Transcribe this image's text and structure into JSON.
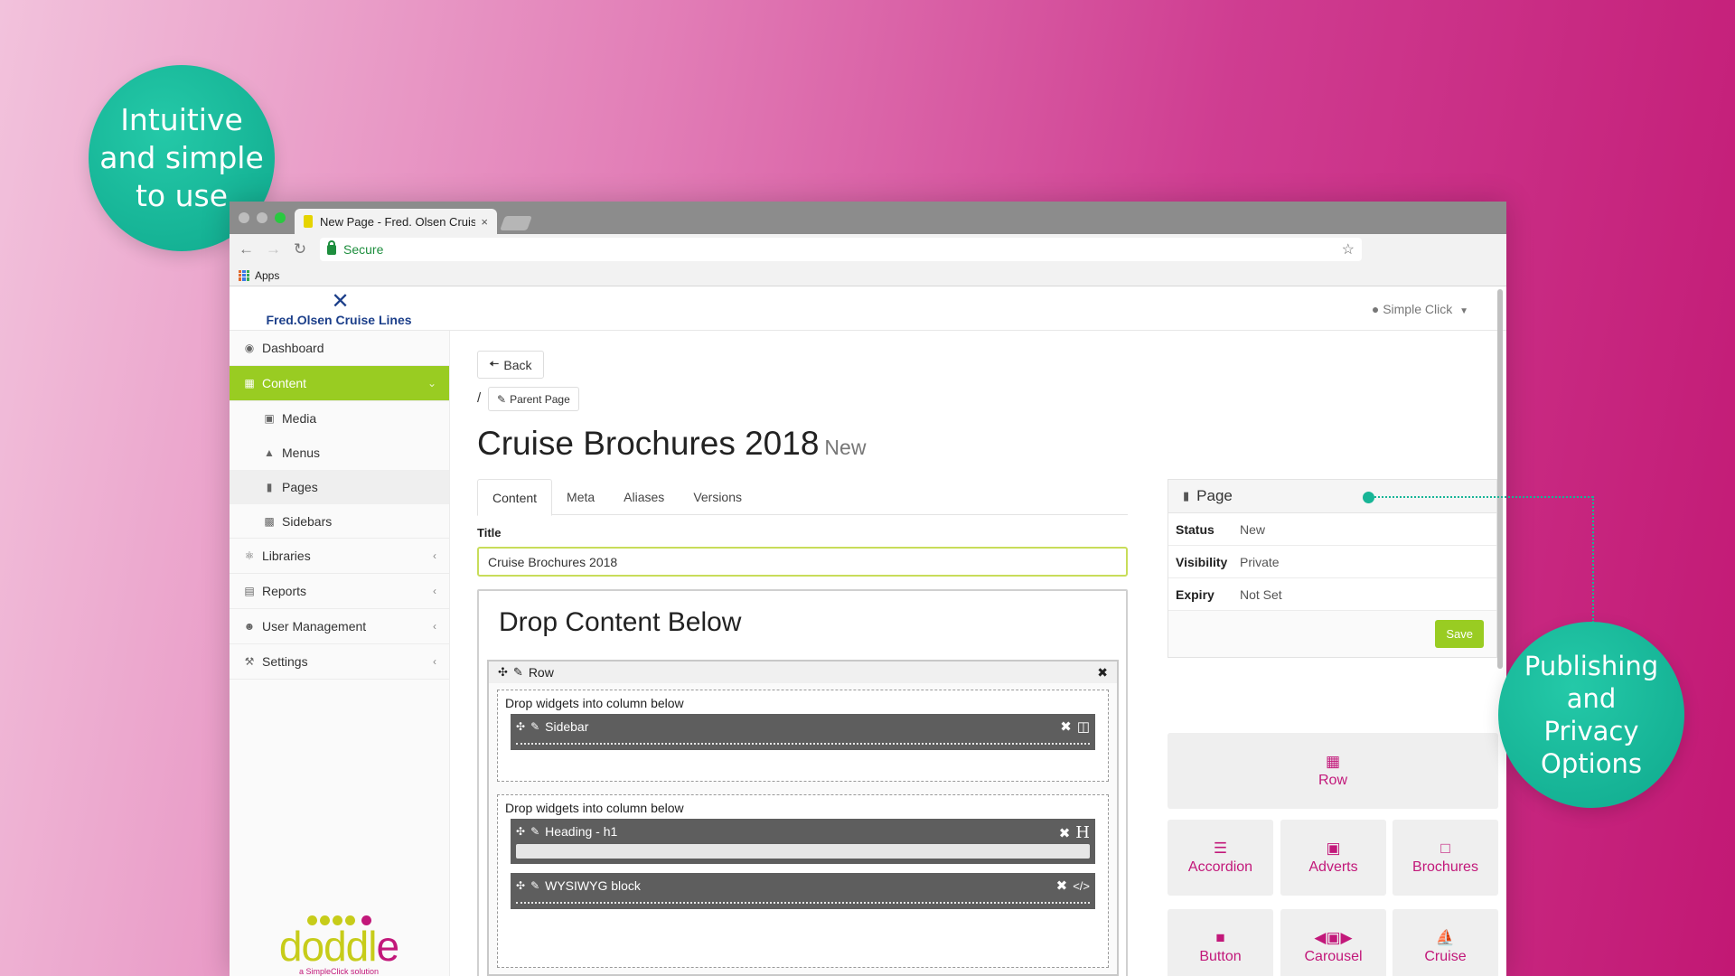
{
  "callouts": {
    "left": [
      "Intuitive",
      "and simple",
      "to use"
    ],
    "right": [
      "Publishing",
      "and",
      "Privacy",
      "Options"
    ]
  },
  "browser": {
    "tab_title": "New Page - Fred. Olsen Cruise",
    "tab_close": "×",
    "url_text": "Secure",
    "bookmark_apps": "Apps",
    "icons": {
      "back": "←",
      "forward": "→",
      "reload": "↻",
      "star": "☆"
    }
  },
  "header": {
    "logo_text": "Fred.Olsen Cruise Lines",
    "logo_mark": "✕",
    "user_label": "Simple Click"
  },
  "sidebar": {
    "items": [
      {
        "label": "Dashboard",
        "icon": "dashboard-icon"
      },
      {
        "label": "Content",
        "icon": "content-icon",
        "active": true
      },
      {
        "label": "Libraries",
        "icon": "libraries-icon"
      },
      {
        "label": "Reports",
        "icon": "reports-icon"
      },
      {
        "label": "User Management",
        "icon": "users-icon"
      },
      {
        "label": "Settings",
        "icon": "wrench-icon"
      }
    ],
    "sub_items": [
      {
        "label": "Media",
        "icon": "image-icon"
      },
      {
        "label": "Menus",
        "icon": "sitemap-icon"
      },
      {
        "label": "Pages",
        "icon": "book-icon",
        "current": true
      },
      {
        "label": "Sidebars",
        "icon": "grid-icon"
      }
    ],
    "brand": {
      "word_main": "doddl",
      "word_end": "e",
      "tagline": "a SimpleClick solution"
    }
  },
  "main": {
    "back_label": "Back",
    "crumb_separator": "/",
    "parent_label": "Parent Page",
    "page_title": "Cruise Brochures 2018",
    "page_badge": "New",
    "tabs": [
      "Content",
      "Meta",
      "Aliases",
      "Versions"
    ],
    "title_field_label": "Title",
    "title_field_value": "Cruise Brochures 2018"
  },
  "builder": {
    "heading": "Drop Content Below",
    "row_label": "Row",
    "column_label": "Drop widgets into column below",
    "widgets": {
      "sidebar": "Sidebar",
      "heading": "Heading - h1",
      "wysiwyg": "WYSIWYG block"
    }
  },
  "page_panel": {
    "heading": "Page",
    "rows": [
      {
        "key": "Status",
        "value": "New"
      },
      {
        "key": "Visibility",
        "value": "Private"
      },
      {
        "key": "Expiry",
        "value": "Not Set"
      }
    ],
    "save_label": "Save"
  },
  "widget_palette": {
    "row": "Row",
    "tiles": [
      "Accordion",
      "Adverts",
      "Brochures",
      "Button",
      "Carousel",
      "Cruise"
    ]
  },
  "colors": {
    "accent_green": "#99cc22",
    "widget_magenta": "#c2187a",
    "callout_teal": "#18b596"
  }
}
